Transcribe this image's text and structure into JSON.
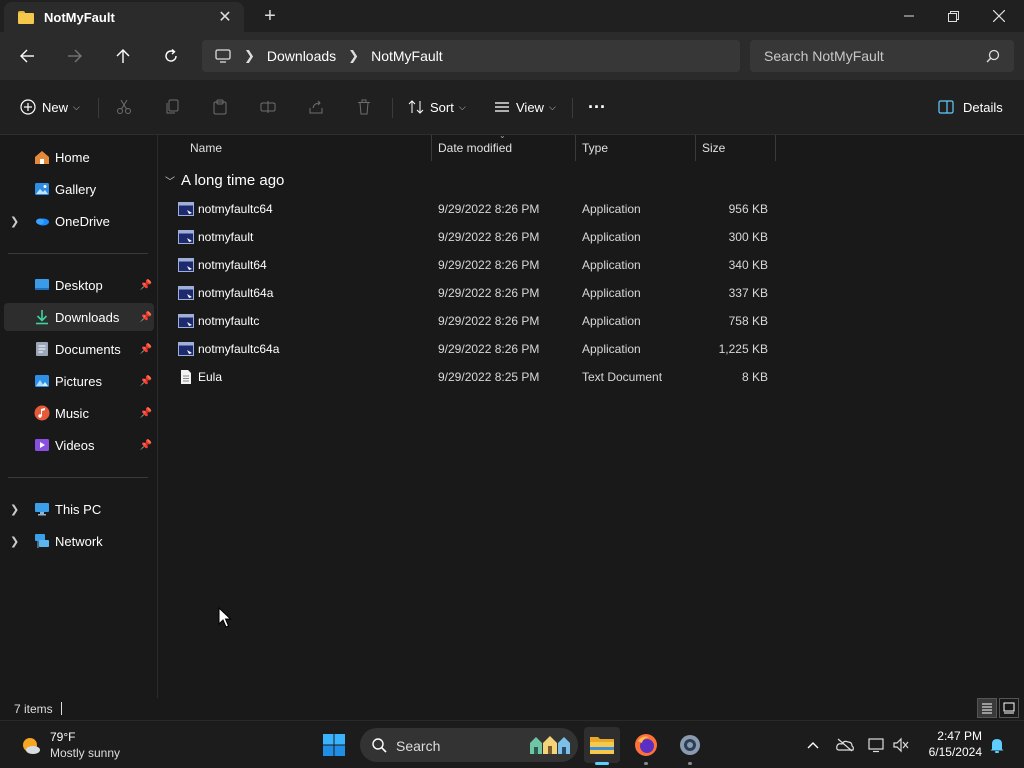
{
  "window": {
    "tab_title": "NotMyFault",
    "tab_close": "✕",
    "new_tab": "+"
  },
  "address": {
    "breadcrumbs": [
      "Downloads",
      "NotMyFault"
    ],
    "search_placeholder": "Search NotMyFault"
  },
  "commands": {
    "new_label": "New",
    "sort_label": "Sort",
    "view_label": "View",
    "more_label": "···",
    "details_label": "Details"
  },
  "sidebar": {
    "items": [
      {
        "label": "Home",
        "icon": "home-icon"
      },
      {
        "label": "Gallery",
        "icon": "gallery-icon"
      },
      {
        "label": "OneDrive",
        "icon": "onedrive-icon"
      },
      {
        "label": "Desktop",
        "icon": "desktop-icon"
      },
      {
        "label": "Downloads",
        "icon": "downloads-icon"
      },
      {
        "label": "Documents",
        "icon": "documents-icon"
      },
      {
        "label": "Pictures",
        "icon": "pictures-icon"
      },
      {
        "label": "Music",
        "icon": "music-icon"
      },
      {
        "label": "Videos",
        "icon": "videos-icon"
      },
      {
        "label": "This PC",
        "icon": "this-pc-icon"
      },
      {
        "label": "Network",
        "icon": "network-icon"
      }
    ]
  },
  "list": {
    "columns": [
      "Name",
      "Date modified",
      "Type",
      "Size"
    ],
    "group_label": "A long time ago",
    "files": [
      {
        "name": "notmyfaultc64",
        "date": "9/29/2022 8:26 PM",
        "type": "Application",
        "size": "956 KB"
      },
      {
        "name": "notmyfault",
        "date": "9/29/2022 8:26 PM",
        "type": "Application",
        "size": "300 KB"
      },
      {
        "name": "notmyfault64",
        "date": "9/29/2022 8:26 PM",
        "type": "Application",
        "size": "340 KB"
      },
      {
        "name": "notmyfault64a",
        "date": "9/29/2022 8:26 PM",
        "type": "Application",
        "size": "337 KB"
      },
      {
        "name": "notmyfaultc",
        "date": "9/29/2022 8:26 PM",
        "type": "Application",
        "size": "758 KB"
      },
      {
        "name": "notmyfaultc64a",
        "date": "9/29/2022 8:26 PM",
        "type": "Application",
        "size": "1,225 KB"
      },
      {
        "name": "Eula",
        "date": "9/29/2022 8:25 PM",
        "type": "Text Document",
        "size": "8 KB"
      }
    ]
  },
  "status": {
    "item_count": "7 items"
  },
  "taskbar": {
    "weather_temp": "79°F",
    "weather_condition": "Mostly sunny",
    "search_label": "Search",
    "time": "2:47 PM",
    "date": "6/15/2024"
  },
  "colors": {
    "background": "#191919",
    "accent": "#60cdff",
    "folder": "#f5c84c"
  }
}
